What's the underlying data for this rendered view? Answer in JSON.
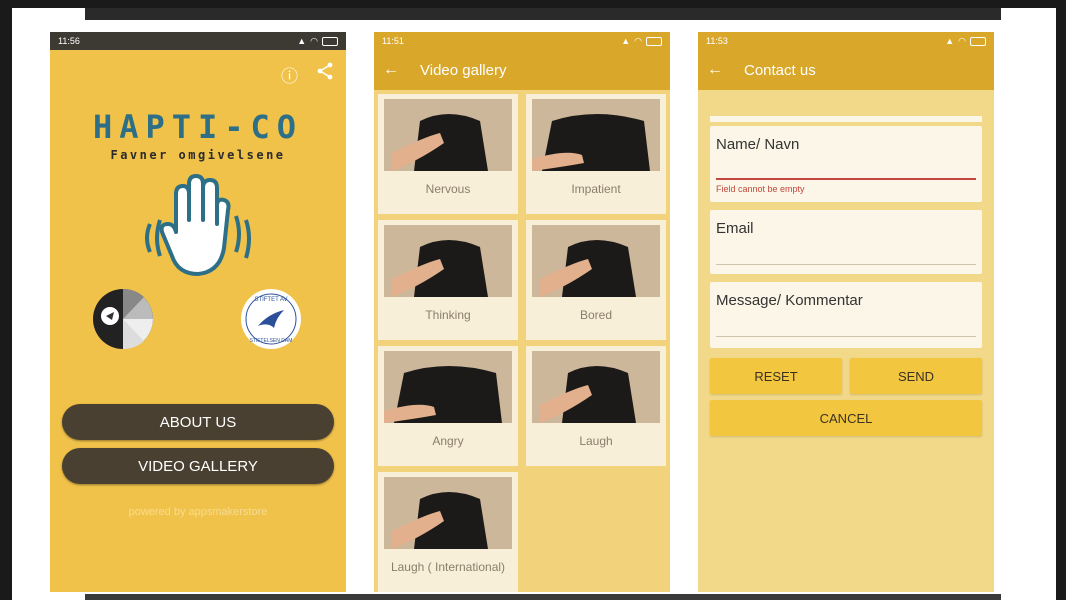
{
  "screens": [
    {
      "status_time": "11:56",
      "title": "HAPTI-CO",
      "subtitle": "Favner omgivelsene",
      "toolbar_icons": [
        "info-icon",
        "share-icon"
      ],
      "buttons": {
        "about": "ABOUT US",
        "gallery": "VIDEO GALLERY"
      },
      "powered_by": "powered by appsmakerstore",
      "badge_right_text": "STIFTET AV STIFTELSEN DAM"
    },
    {
      "status_time": "11:51",
      "title": "Video gallery",
      "items": [
        {
          "label": "Nervous"
        },
        {
          "label": "Impatient"
        },
        {
          "label": "Thinking"
        },
        {
          "label": "Bored"
        },
        {
          "label": "Angry"
        },
        {
          "label": "Laugh"
        },
        {
          "label": "Laugh ( International)"
        }
      ]
    },
    {
      "status_time": "11:53",
      "title": "Contact us",
      "fields": {
        "name_label": "Name/ Navn",
        "name_error": "Field cannot be empty",
        "email_label": "Email",
        "message_label": "Message/ Kommentar"
      },
      "buttons": {
        "reset": "RESET",
        "send": "SEND",
        "cancel": "CANCEL"
      }
    }
  ],
  "colors": {
    "brand_yellow": "#f1c24a",
    "header_gold": "#d9a72a",
    "logo_teal": "#2c6f86",
    "error_red": "#c0483c"
  }
}
